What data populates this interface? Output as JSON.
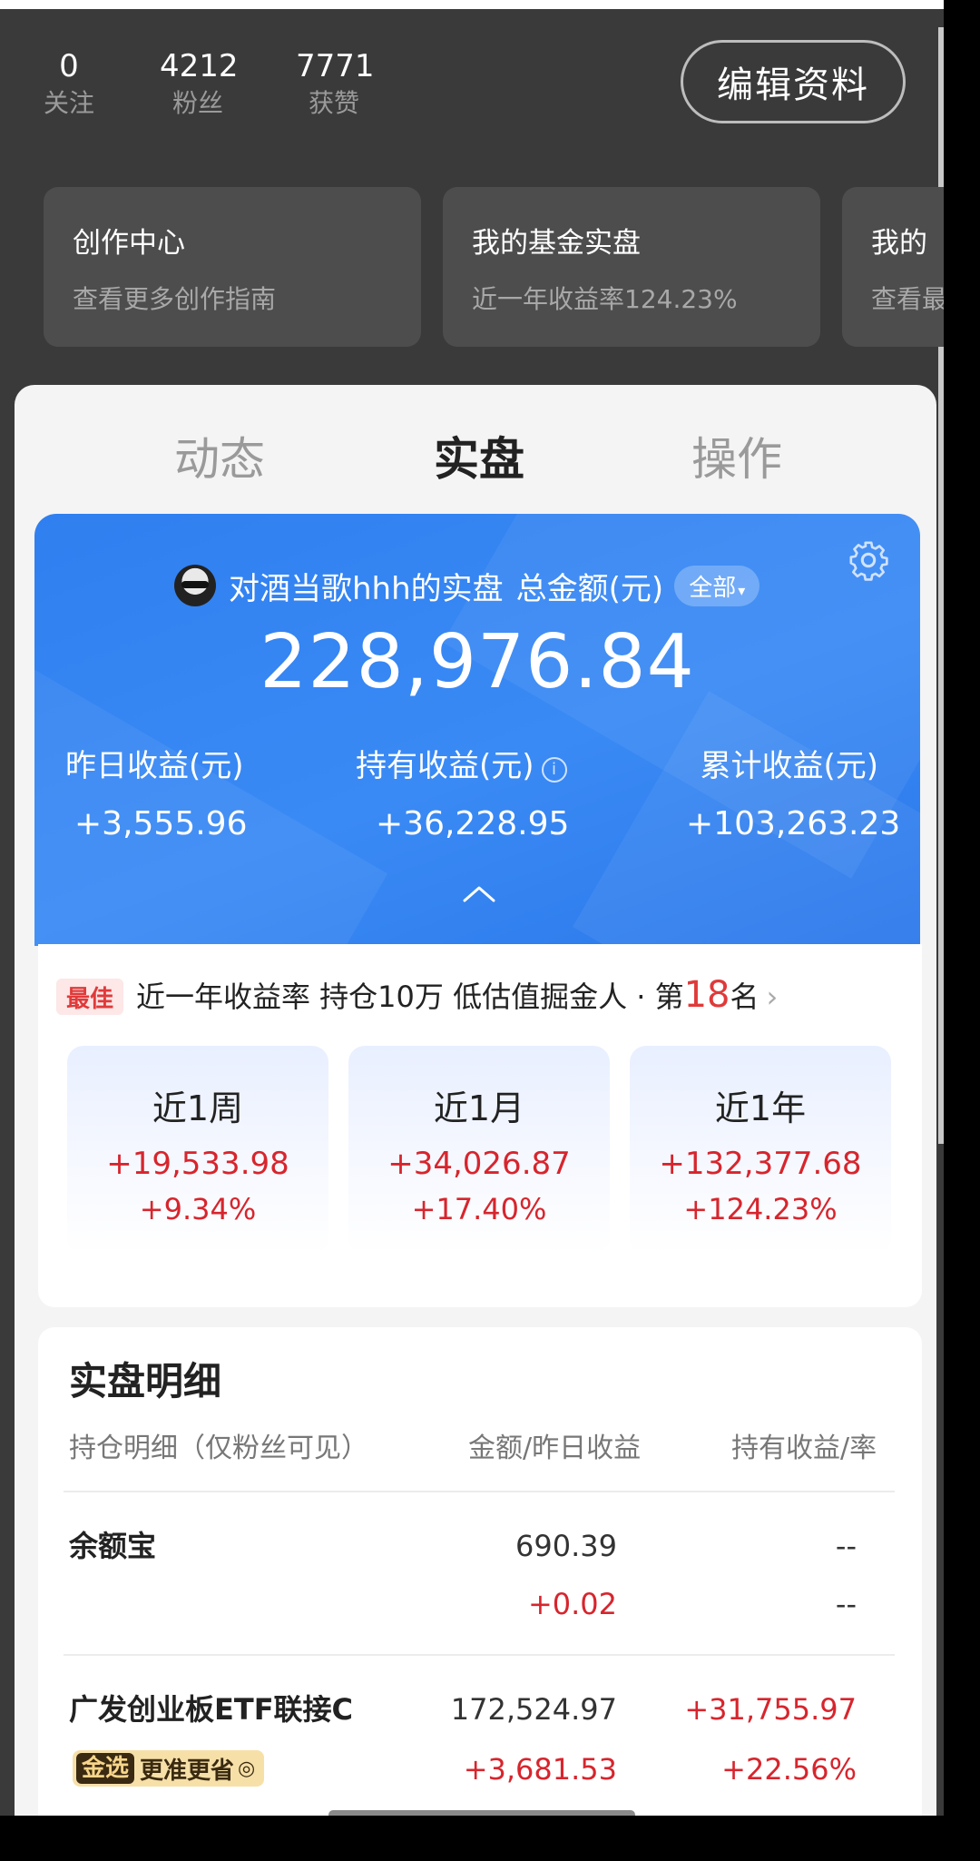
{
  "profile": {
    "stats": [
      {
        "value": "0",
        "label": "关注"
      },
      {
        "value": "4212",
        "label": "粉丝"
      },
      {
        "value": "7771",
        "label": "获赞"
      }
    ],
    "edit_button": "编辑资料"
  },
  "feature_cards": [
    {
      "title": "创作中心",
      "subtitle": "查看更多创作指南"
    },
    {
      "title": "我的基金实盘",
      "subtitle": "近一年收益率124.23%"
    },
    {
      "title": "我的",
      "subtitle": "查看最"
    }
  ],
  "tabs": [
    "动态",
    "实盘",
    "操作"
  ],
  "portfolio": {
    "owner": "对酒当歌hhh的实盘",
    "total_label": "总金额(元)",
    "filter": "全部",
    "total": "228,976.84",
    "metrics": [
      {
        "label": "昨日收益(元)",
        "value": "+3,555.96"
      },
      {
        "label": "持有收益(元)",
        "value": "+36,228.95"
      },
      {
        "label": "累计收益(元)",
        "value": "+103,263.23"
      }
    ]
  },
  "ranking": {
    "tag": "最佳",
    "text": "近一年收益率 持仓10万 低估值掘金人 · 第",
    "rank": "18",
    "suffix": "名"
  },
  "periods": [
    {
      "title": "近1周",
      "amount": "+19,533.98",
      "rate": "+9.34%"
    },
    {
      "title": "近1月",
      "amount": "+34,026.87",
      "rate": "+17.40%"
    },
    {
      "title": "近1年",
      "amount": "+132,377.68",
      "rate": "+124.23%"
    }
  ],
  "detail": {
    "title": "实盘明细",
    "headers": [
      "持仓明细（仅粉丝可见）",
      "金额/昨日收益",
      "持有收益/率"
    ],
    "rows": [
      {
        "name": "余额宝",
        "amount": "690.39",
        "yesterday": "+0.02",
        "hold": "--",
        "rate": "--"
      },
      {
        "name": "广发创业板ETF联接C",
        "amount": "172,524.97",
        "yesterday": "+3,681.53",
        "hold": "+31,755.97",
        "rate": "+22.56%",
        "badge_main": "金选",
        "badge_text": "更准更省"
      }
    ]
  }
}
